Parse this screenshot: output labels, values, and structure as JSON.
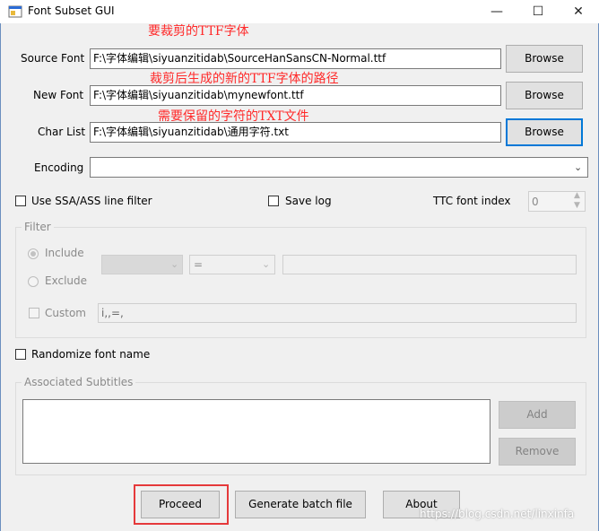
{
  "window": {
    "title": "Font Subset GUI",
    "minimize": "—",
    "maximize": "☐",
    "close": "✕"
  },
  "annotations": {
    "source": "要裁剪的TTF字体",
    "new_font": "裁剪后生成的新的TTF字体的路径",
    "char_list": "需要保留的字符的TXT文件"
  },
  "fields": {
    "source_font": {
      "label": "Source Font",
      "value": "F:\\字体编辑\\siyuanzitidab\\SourceHanSansCN-Normal.ttf",
      "button": "Browse"
    },
    "new_font": {
      "label": "New Font",
      "value": "F:\\字体编辑\\siyuanzitidab\\mynewfont.ttf",
      "button": "Browse"
    },
    "char_list": {
      "label": "Char List",
      "value": "F:\\字体编辑\\siyuanzitidab\\通用字符.txt",
      "button": "Browse"
    },
    "encoding": {
      "label": "Encoding",
      "value": ""
    }
  },
  "options": {
    "ssa_filter": "Use SSA/ASS line filter",
    "save_log": "Save log",
    "ttc_label": "TTC font index",
    "ttc_value": "0",
    "randomize": "Randomize font name"
  },
  "filter": {
    "title": "Filter",
    "include": "Include",
    "exclude": "Exclude",
    "custom": "Custom",
    "operator": "=",
    "custom_value": "i,,=,"
  },
  "subtitles": {
    "title": "Associated Subtitles",
    "add": "Add",
    "remove": "Remove"
  },
  "actions": {
    "proceed": "Proceed",
    "batch": "Generate batch file",
    "about": "About"
  },
  "watermark": "https://blog.csdn.net/linxinfa"
}
